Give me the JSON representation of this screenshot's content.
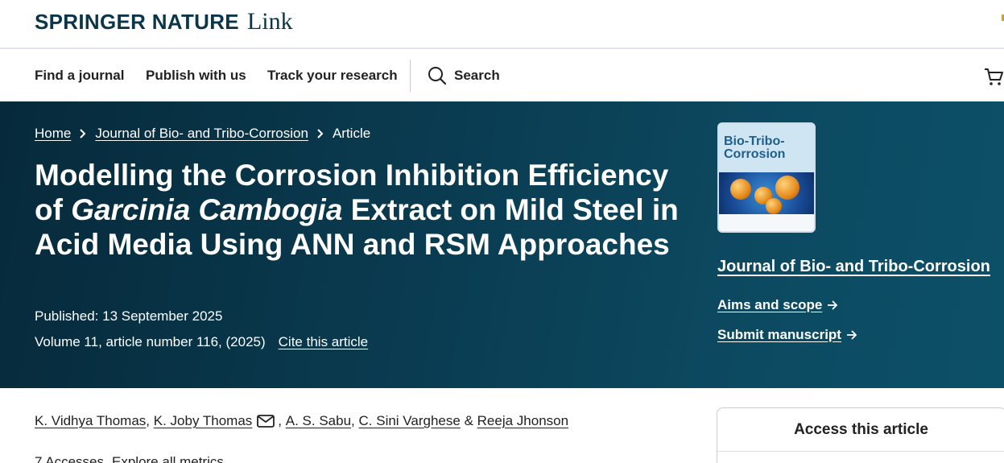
{
  "brand": {
    "name": "SPRINGER NATURE",
    "link": "Link"
  },
  "nav": {
    "items": [
      "Find a journal",
      "Publish with us",
      "Track your research"
    ],
    "search_label": "Search"
  },
  "breadcrumb": {
    "home": "Home",
    "journal": "Journal of Bio- and Tribo-Corrosion",
    "current": "Article"
  },
  "article": {
    "title_part1": "Modelling the Corrosion Inhibition Efficiency of ",
    "title_italic": "Garcinia Cambogia",
    "title_part2": " Extract on Mild Steel in Acid Media Using ANN and RSM Approaches",
    "published": "Published: 13 September 2025",
    "volume": "Volume 11, article number 116, (2025)",
    "cite": "Cite this article"
  },
  "journal_panel": {
    "cover_title": "Bio-Tribo-Corrosion",
    "name": "Journal of Bio- and Tribo-Corrosion",
    "aims": "Aims and scope",
    "submit": "Submit manuscript"
  },
  "authors": {
    "a1": "K. Vidhya Thomas",
    "a2": "K. Joby Thomas",
    "a3": "A. S. Sabu",
    "a4": "C. Sini Varghese",
    "a5": "Reeja Jhonson",
    "sep": ",",
    "amp": "&"
  },
  "metrics": {
    "accesses": "7 Accesses",
    "explore": "Explore all metrics"
  },
  "access": {
    "title": "Access this article"
  },
  "icons": [
    "search-icon",
    "cart-icon",
    "chevron-right-icon",
    "arrow-right-icon",
    "mail-icon"
  ]
}
